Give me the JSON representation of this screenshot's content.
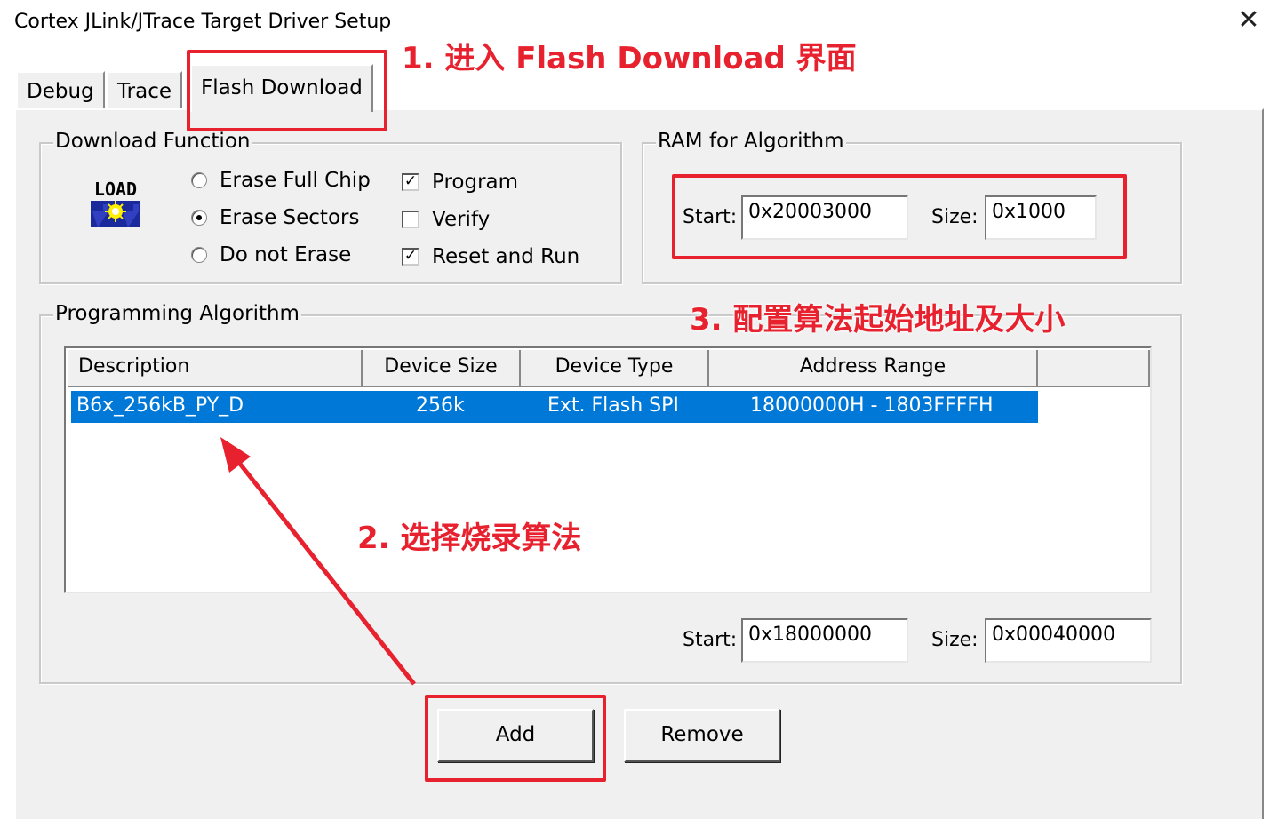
{
  "window": {
    "title": "Cortex JLink/JTrace Target Driver Setup",
    "close_glyph": "✕"
  },
  "tabs": [
    {
      "label": "Debug",
      "active": false
    },
    {
      "label": "Trace",
      "active": false
    },
    {
      "label": "Flash Download",
      "active": true
    }
  ],
  "download_function": {
    "legend": "Download Function",
    "icon_text": "LOAD",
    "erase_options": [
      {
        "label": "Erase Full Chip",
        "selected": false
      },
      {
        "label": "Erase Sectors",
        "selected": true
      },
      {
        "label": "Do not Erase",
        "selected": false
      }
    ],
    "checks": [
      {
        "label": "Program",
        "checked": true
      },
      {
        "label": "Verify",
        "checked": false
      },
      {
        "label": "Reset and Run",
        "checked": true
      }
    ]
  },
  "ram_for_algorithm": {
    "legend": "RAM for Algorithm",
    "start_label": "Start:",
    "start_value": "0x20003000",
    "size_label": "Size:",
    "size_value": "0x1000"
  },
  "programming_algorithm": {
    "legend": "Programming Algorithm",
    "columns": [
      "Description",
      "Device Size",
      "Device Type",
      "Address Range"
    ],
    "rows": [
      {
        "description": "B6x_256kB_PY_D",
        "device_size": "256k",
        "device_type": "Ext. Flash SPI",
        "address_range": "18000000H - 1803FFFFH",
        "selected": true
      }
    ],
    "start_label": "Start:",
    "start_value": "0x18000000",
    "size_label": "Size:",
    "size_value": "0x00040000"
  },
  "buttons": {
    "add": "Add",
    "remove": "Remove"
  },
  "annotations": {
    "step1": "1. 进入 Flash Download 界面",
    "step2": "2. 选择烧录算法",
    "step3": "3. 配置算法起始地址及大小"
  },
  "colors": {
    "selection": "#0078d7",
    "annotation": "#e8212f",
    "dialog_bg": "#f0f0f0"
  }
}
